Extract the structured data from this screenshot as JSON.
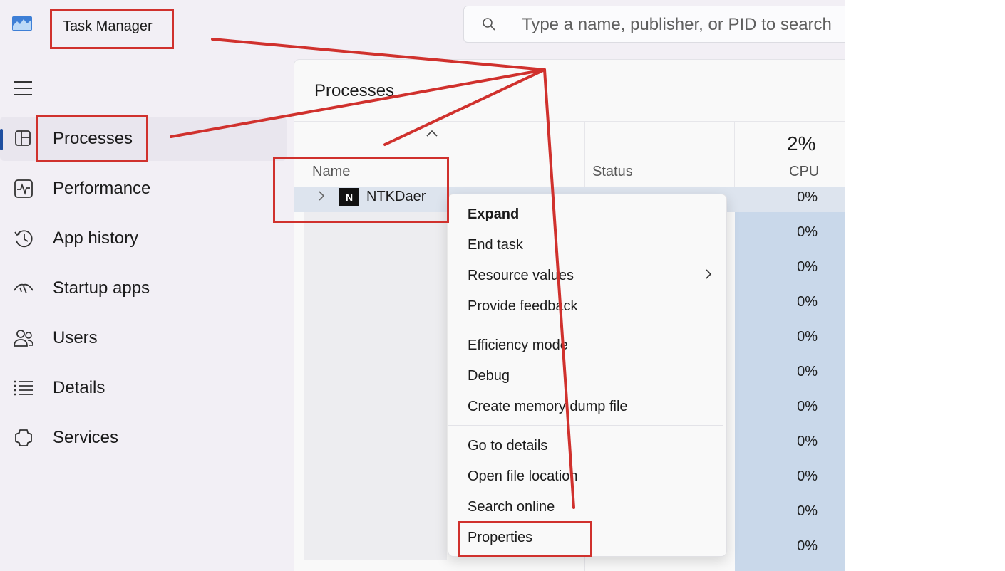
{
  "app": {
    "title": "Task Manager"
  },
  "search": {
    "placeholder": "Type a name, publisher, or PID to search"
  },
  "sidebar": {
    "items": [
      {
        "label": "Processes",
        "icon": "processes-icon",
        "active": true
      },
      {
        "label": "Performance",
        "icon": "performance-icon"
      },
      {
        "label": "App history",
        "icon": "app-history-icon"
      },
      {
        "label": "Startup apps",
        "icon": "startup-apps-icon"
      },
      {
        "label": "Users",
        "icon": "users-icon"
      },
      {
        "label": "Details",
        "icon": "details-icon"
      },
      {
        "label": "Services",
        "icon": "services-icon"
      }
    ]
  },
  "main": {
    "title": "Processes",
    "columns": {
      "name": "Name",
      "status": "Status",
      "cpu": "CPU",
      "cpu_total": "2%"
    },
    "process": {
      "name": "NTKDaer",
      "icon_glyph": "N"
    },
    "cpu_values": [
      "0%",
      "0%",
      "0%",
      "0%",
      "0%",
      "0%",
      "0%",
      "0%",
      "0%",
      "0%",
      "0%"
    ]
  },
  "context_menu": {
    "items": [
      "Expand",
      "End task",
      "Resource values",
      "Provide feedback",
      "Efficiency mode",
      "Debug",
      "Create memory dump file",
      "Go to details",
      "Open file location",
      "Search online",
      "Properties"
    ]
  },
  "colors": {
    "accent": "#1f4fa0",
    "annotation": "#d0312d",
    "cpu_highlight": "#c9d8ea"
  }
}
